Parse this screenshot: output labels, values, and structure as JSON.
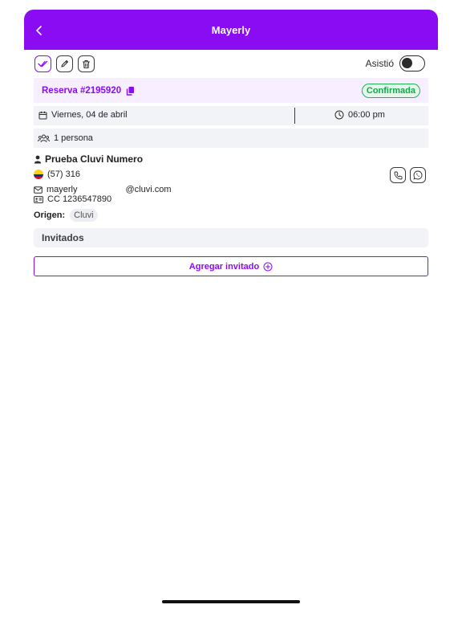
{
  "header": {
    "title": "Mayerly",
    "back_icon": "chevron-left-icon"
  },
  "toolbar": {
    "icons": [
      "double-check-icon",
      "pencil-icon",
      "trash-icon"
    ]
  },
  "asistio": {
    "label": "Asistió",
    "checked": false
  },
  "reservation": {
    "number": "Reserva #2195920",
    "status": "Confirmada",
    "status_color": "#14a54b"
  },
  "schedule": {
    "date": "Viernes, 04 de abril",
    "time": "06:00 pm"
  },
  "party": {
    "people": "1 persona"
  },
  "client": {
    "name": "Prueba Cluvi Numero",
    "phone": "(57) 316",
    "email_user": "mayerly",
    "email_domain": "@cluvi.com",
    "document": "CC 1236547890",
    "origin_label": "Origen:",
    "origin_value": "Cluvi"
  },
  "guests": {
    "title": "Invitados",
    "add_label": "Agregar invitado"
  },
  "colors": {
    "accent": "#8a0cf2",
    "confirmed": "#14a54b"
  }
}
